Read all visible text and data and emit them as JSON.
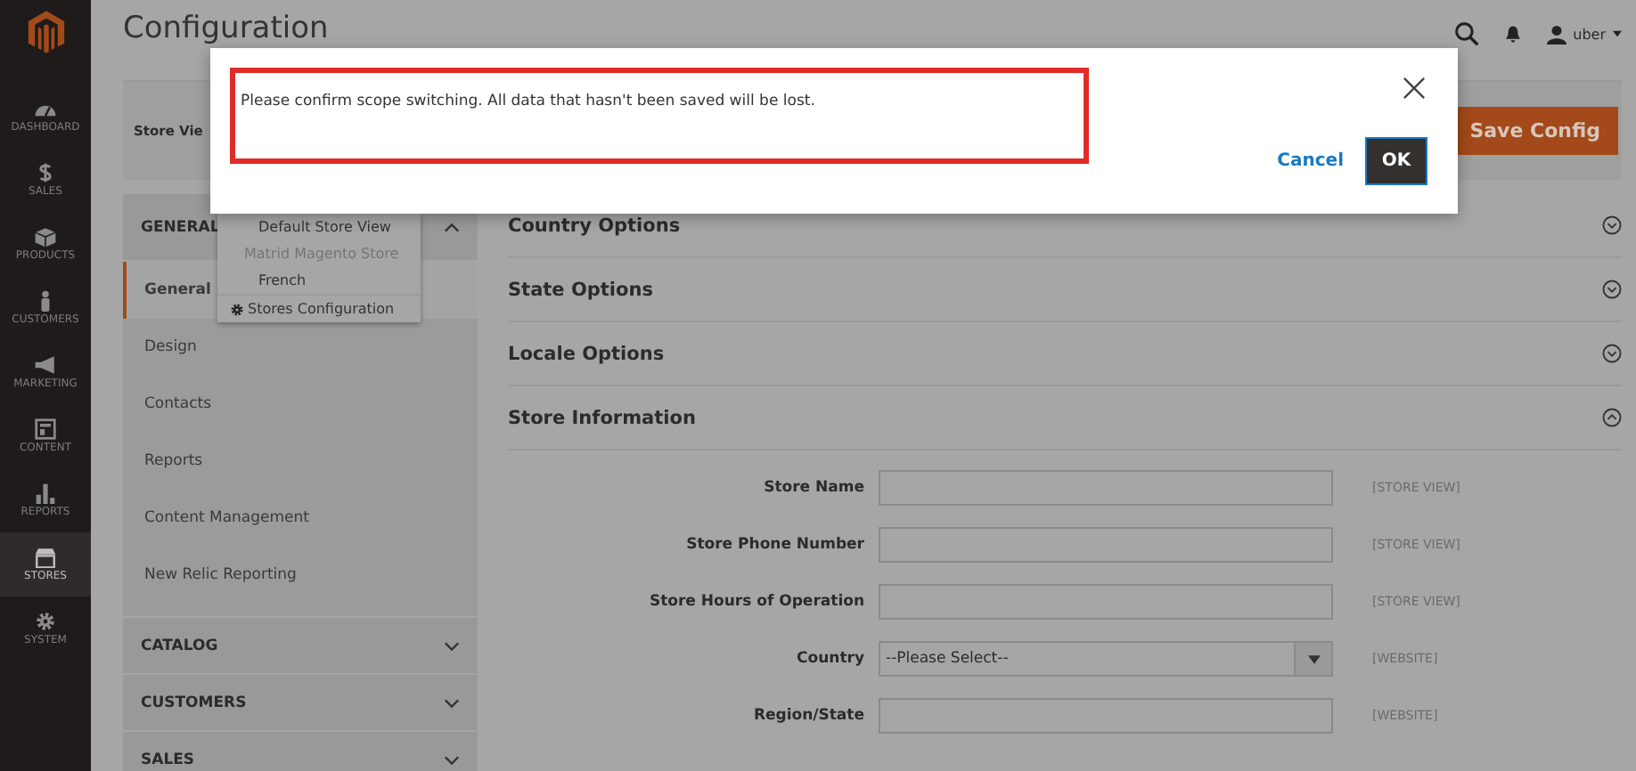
{
  "sidebar": {
    "items": [
      {
        "label": "DASHBOARD",
        "kind": "dashboard",
        "selected": false
      },
      {
        "label": "SALES",
        "kind": "sales",
        "selected": false
      },
      {
        "label": "PRODUCTS",
        "kind": "products",
        "selected": false
      },
      {
        "label": "CUSTOMERS",
        "kind": "customers",
        "selected": false
      },
      {
        "label": "MARKETING",
        "kind": "marketing",
        "selected": false
      },
      {
        "label": "CONTENT",
        "kind": "content",
        "selected": false
      },
      {
        "label": "REPORTS",
        "kind": "reports",
        "selected": false
      },
      {
        "label": "STORES",
        "kind": "stores",
        "selected": true
      },
      {
        "label": "SYSTEM",
        "kind": "system",
        "selected": false
      }
    ]
  },
  "header": {
    "title": "Configuration",
    "user": "uber"
  },
  "scope_bar": {
    "label": "Store Vie",
    "save_button": "Save Config"
  },
  "config_tabs": [
    {
      "label": "GENERAL",
      "expanded": true,
      "items": [
        {
          "label": "General",
          "selected": true
        },
        {
          "label": "Design",
          "selected": false
        },
        {
          "label": "Contacts",
          "selected": false
        },
        {
          "label": "Reports",
          "selected": false
        },
        {
          "label": "Content Management",
          "selected": false
        },
        {
          "label": "New Relic Reporting",
          "selected": false
        }
      ]
    },
    {
      "label": "CATALOG",
      "expanded": false
    },
    {
      "label": "CUSTOMERS",
      "expanded": false
    },
    {
      "label": "SALES",
      "expanded": false
    }
  ],
  "scope_menu": {
    "items": [
      {
        "label": "Default Store View",
        "kind": "view"
      },
      {
        "label": "Matrid Magento Store",
        "kind": "store"
      },
      {
        "label": "French",
        "kind": "view"
      }
    ],
    "footer": "Stores Configuration"
  },
  "sections": [
    {
      "title": "Country Options",
      "expanded": false
    },
    {
      "title": "State Options",
      "expanded": false
    },
    {
      "title": "Locale Options",
      "expanded": false
    },
    {
      "title": "Store Information",
      "expanded": true,
      "fields": [
        {
          "label": "Store Name",
          "kind": "text",
          "scope": "[STORE VIEW]"
        },
        {
          "label": "Store Phone Number",
          "kind": "text",
          "scope": "[STORE VIEW]"
        },
        {
          "label": "Store Hours of Operation",
          "kind": "text",
          "scope": "[STORE VIEW]"
        },
        {
          "label": "Country",
          "kind": "select",
          "value": "--Please Select--",
          "scope": "[WEBSITE]"
        },
        {
          "label": "Region/State",
          "kind": "text",
          "scope": "[WEBSITE]"
        }
      ]
    }
  ],
  "dialog": {
    "message": "Please confirm scope switching. All data that hasn't been saved will be lost.",
    "cancel": "Cancel",
    "ok": "OK"
  }
}
